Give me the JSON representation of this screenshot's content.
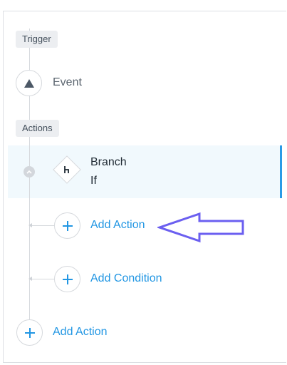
{
  "workflow": {
    "trigger_section_label": "Trigger",
    "trigger_event_label": "Event",
    "actions_section_label": "Actions",
    "branch": {
      "title": "Branch",
      "subtitle": "If"
    },
    "branch_add_action_label": "Add Action",
    "branch_add_condition_label": "Add Condition",
    "root_add_action_label": "Add Action"
  },
  "icons": {
    "trigger": "triangle-up-icon",
    "branch": "branch-icon",
    "add": "plus-icon",
    "collapse": "chevron-up-icon",
    "annotation": "arrow-left-icon"
  },
  "colors": {
    "accent": "#2196e3",
    "selected_row_bg": "#f1f9fd",
    "selected_row_border": "#2a9be6",
    "annotation_arrow": "#6b5ff0"
  }
}
